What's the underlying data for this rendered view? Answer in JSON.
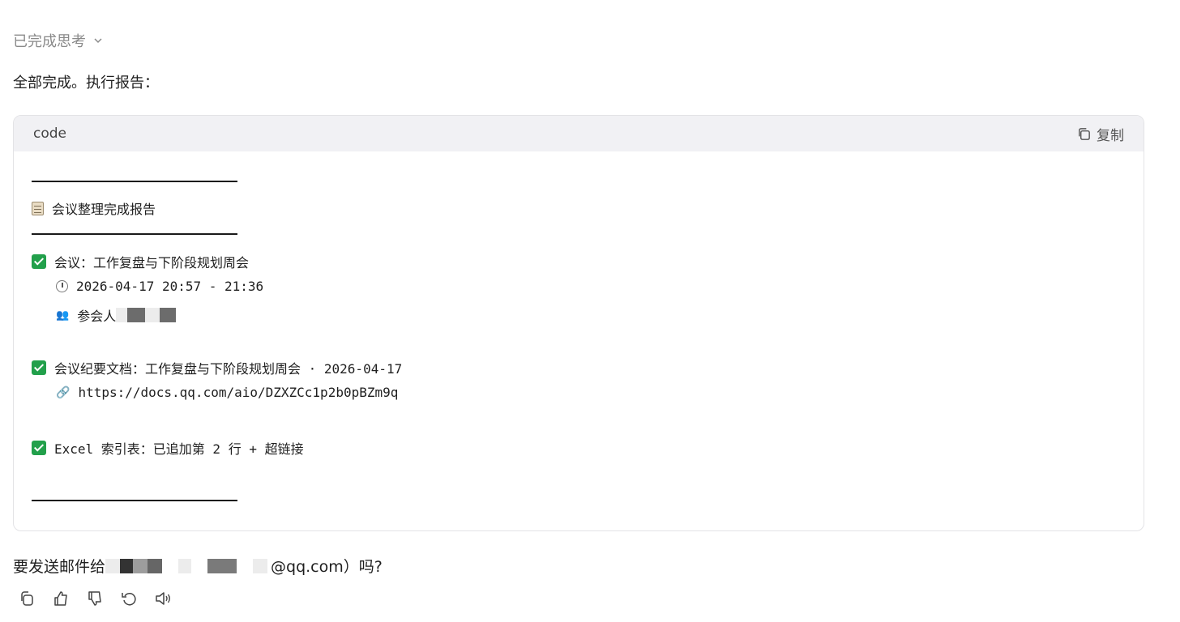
{
  "thinking": {
    "label": "已完成思考"
  },
  "intro": "全部完成。执行报告：",
  "code": {
    "lang": "code",
    "copy_label": "复制",
    "report_title": "会议整理完成报告",
    "meeting_line": "会议：工作复盘与下阶段规划周会",
    "time_line": "2026-04-17 20:57 - 21:36",
    "attendees_label": "参会人",
    "doc_line": "会议纪要文档：工作复盘与下阶段规划周会 · 2026-04-17",
    "doc_url": "https://docs.qq.com/aio/DZXZCc1p2b0pBZm9q",
    "excel_line": "Excel 索引表：已追加第 2 行 + 超链接"
  },
  "question": {
    "prefix": "要发送邮件给",
    "suffix": "@qq.com）吗?"
  },
  "icons": {
    "thinking_toggle": "chevron-down-icon",
    "copy": "copy-icon",
    "report": "clipboard-icon",
    "check": "check-icon",
    "time": "clock-icon",
    "attendees": "people-icon",
    "link": "link-icon",
    "actions": [
      "copy-icon",
      "thumbs-up-icon",
      "thumbs-down-icon",
      "regenerate-icon",
      "speaker-icon"
    ]
  },
  "colors": {
    "check_green": "#22a04b",
    "code_header_bg": "#f1f1f4",
    "muted_text": "#8a8a8a"
  }
}
